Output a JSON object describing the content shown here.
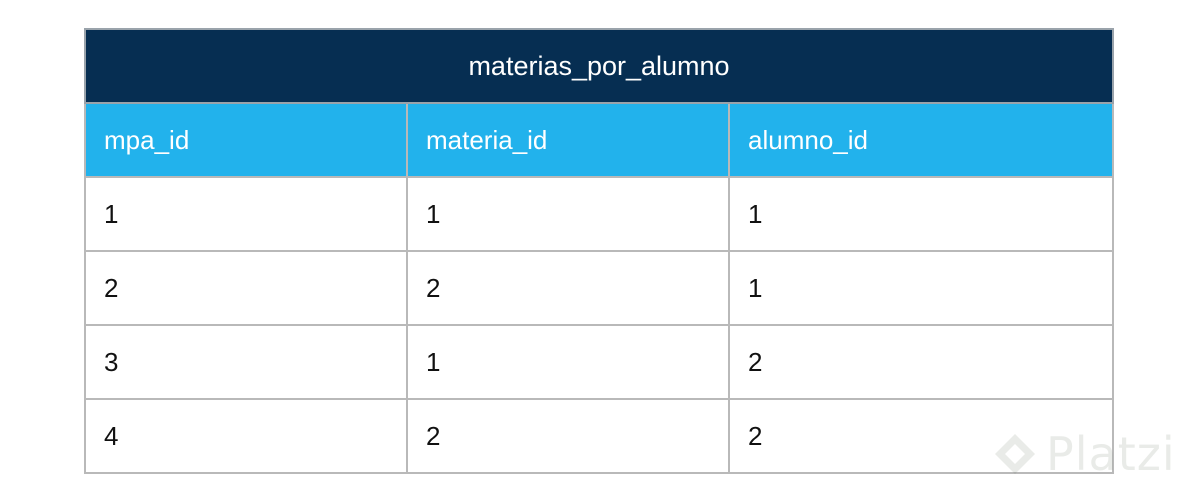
{
  "table": {
    "title": "materias_por_alumno",
    "columns": [
      "mpa_id",
      "materia_id",
      "alumno_id"
    ],
    "rows": [
      [
        "1",
        "1",
        "1"
      ],
      [
        "2",
        "2",
        "1"
      ],
      [
        "3",
        "1",
        "2"
      ],
      [
        "4",
        "2",
        "2"
      ]
    ]
  },
  "watermark": {
    "text": "Platzi"
  },
  "colors": {
    "title_bg": "#062e52",
    "header_bg": "#22b2ec",
    "border": "#b9b9b9"
  },
  "icons": {
    "watermark_logo": "platzi-logo-icon"
  }
}
